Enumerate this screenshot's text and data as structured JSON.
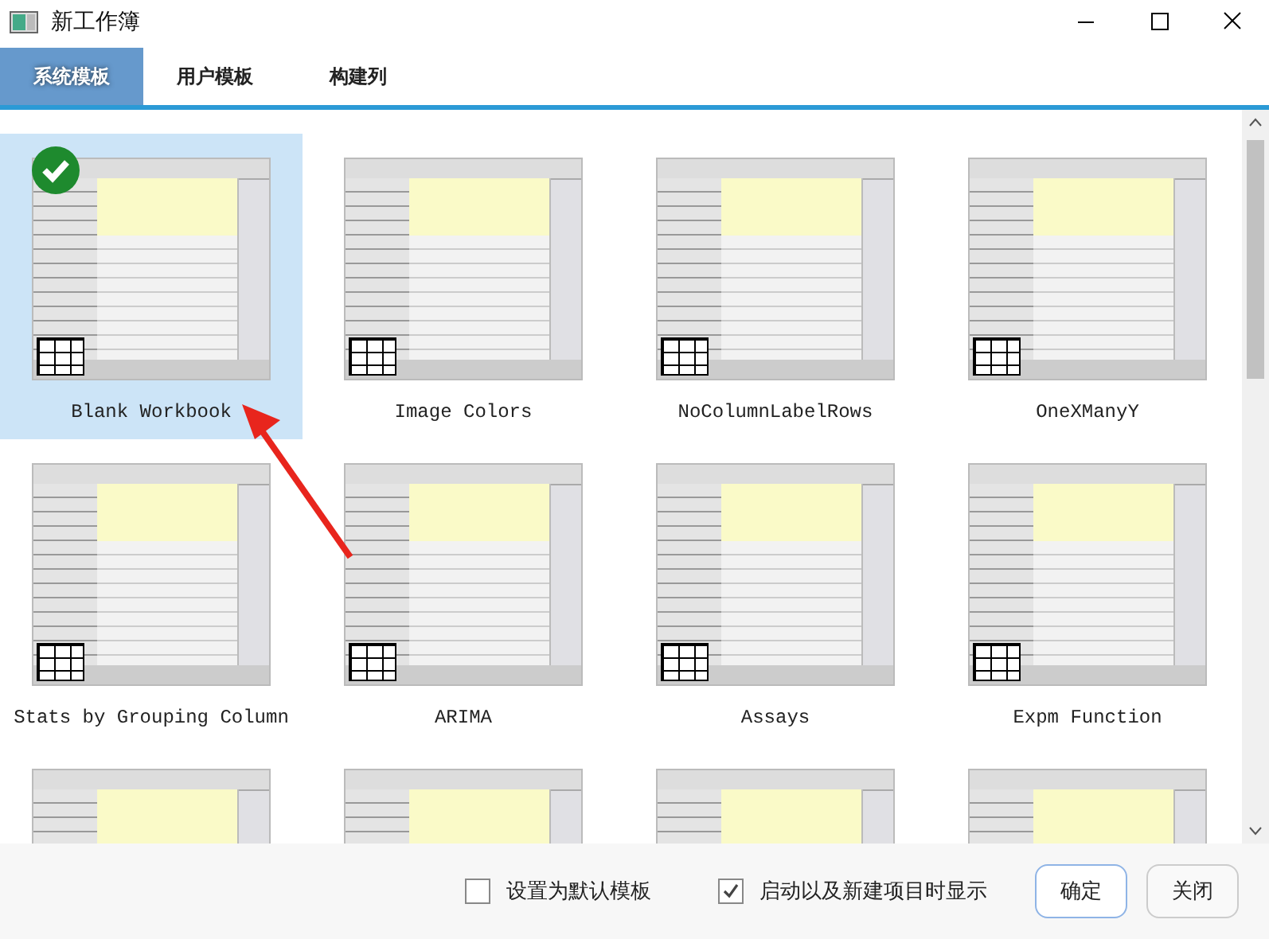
{
  "window": {
    "title": "新工作簿"
  },
  "tabs": [
    {
      "label": "系统模板",
      "selected": true
    },
    {
      "label": "用户模板",
      "selected": false
    },
    {
      "label": "构建列",
      "selected": false
    }
  ],
  "templates": [
    {
      "label": "Blank Workbook",
      "selected": true
    },
    {
      "label": "Image Colors",
      "selected": false
    },
    {
      "label": "NoColumnLabelRows",
      "selected": false
    },
    {
      "label": "OneXManyY",
      "selected": false
    },
    {
      "label": "Stats by Grouping Column",
      "selected": false
    },
    {
      "label": "ARIMA",
      "selected": false
    },
    {
      "label": "Assays",
      "selected": false
    },
    {
      "label": "Expm Function",
      "selected": false
    },
    {
      "selected": false
    },
    {
      "selected": false
    },
    {
      "selected": false
    },
    {
      "selected": false
    }
  ],
  "options": [
    {
      "label": "设置为默认模板",
      "checked": false
    },
    {
      "label": "启动以及新建项目时显示",
      "checked": true
    }
  ],
  "buttons": [
    {
      "label": "确定",
      "kind": "primary"
    },
    {
      "label": "关闭",
      "kind": "normal"
    }
  ]
}
